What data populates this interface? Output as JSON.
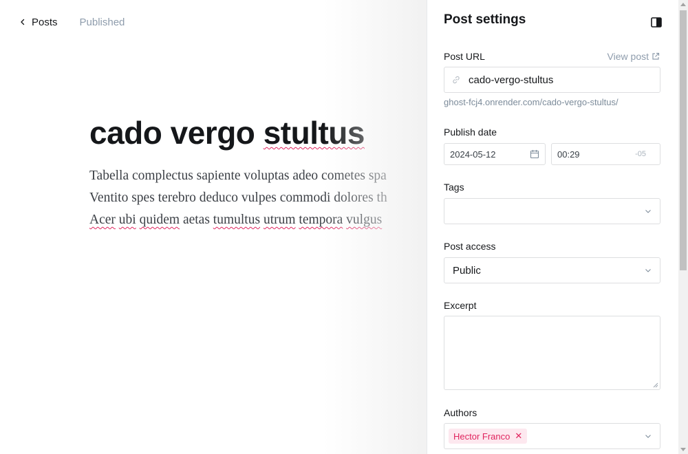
{
  "editor": {
    "back_label": "Posts",
    "status": "Published",
    "title": "cado vergo stultus",
    "title_words": [
      "cado vergo ",
      "stultus"
    ],
    "body_lines": [
      "Tabella complectus sapiente voluptas adeo cometes spa",
      "Ventito spes terebro deduco vulpes commodi dolores th"
    ],
    "body_line3": {
      "w1": "Acer",
      "w2": "ubi",
      "w3": "quidem",
      "w4": "aetas",
      "w5": "tumultus",
      "w6": "utrum",
      "w7": "tempora",
      "w8": "vulgus"
    }
  },
  "settings": {
    "title": "Post settings",
    "post_url": {
      "label": "Post URL",
      "view_post": "View post",
      "value": "cado-vergo-stultus",
      "hint": "ghost-fcj4.onrender.com/cado-vergo-stultus/"
    },
    "publish_date": {
      "label": "Publish date",
      "date": "2024-05-12",
      "time": "00:29",
      "timezone": "-05"
    },
    "tags": {
      "label": "Tags",
      "value": ""
    },
    "post_access": {
      "label": "Post access",
      "value": "Public"
    },
    "excerpt": {
      "label": "Excerpt",
      "value": ""
    },
    "authors": {
      "label": "Authors",
      "chips": [
        "Hector Franco"
      ]
    }
  },
  "icons": {
    "back": "chevron-left-icon",
    "toggle": "sidebar-toggle-icon",
    "link": "link-icon",
    "external": "external-link-icon",
    "calendar": "calendar-icon",
    "chevron": "chevron-down-icon",
    "remove": "close-icon"
  },
  "colors": {
    "accent_pink": "#e0245e",
    "chip_bg": "#fde8ef",
    "muted": "#8e9cac",
    "border": "#dddee0"
  }
}
